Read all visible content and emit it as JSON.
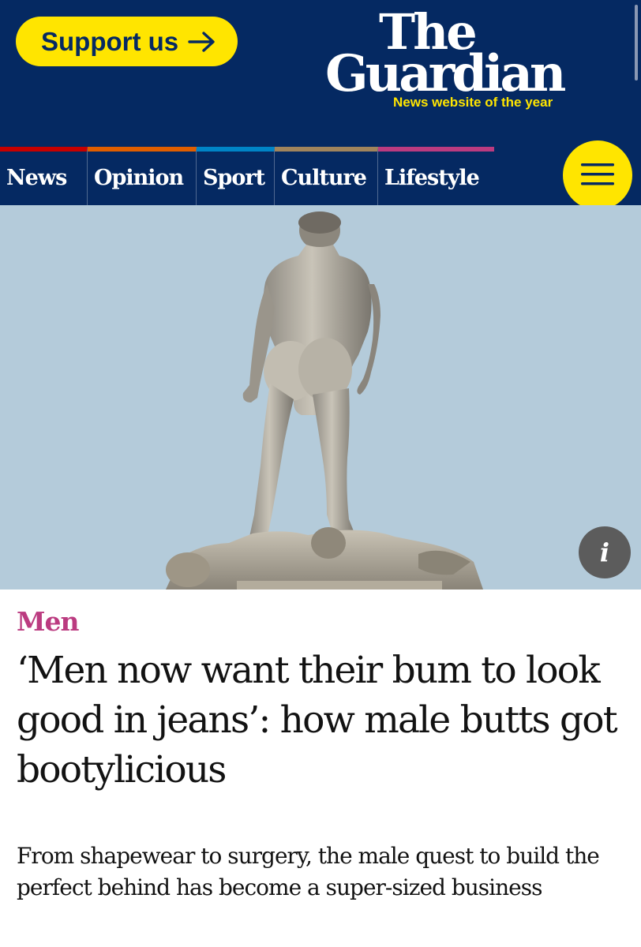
{
  "header": {
    "support_label": "Support us",
    "logo_line1": "The",
    "logo_line2": "Guardian",
    "tagline": "News website of the year",
    "menu_icon": "hamburger-menu-icon"
  },
  "nav": {
    "pillars": [
      {
        "label": "News",
        "color": "#c70000"
      },
      {
        "label": "Opinion",
        "color": "#e05e00"
      },
      {
        "label": "Sport",
        "color": "#0084c6"
      },
      {
        "label": "Culture",
        "color": "#a1845c"
      },
      {
        "label": "Lifestyle",
        "color": "#bb3b80"
      }
    ]
  },
  "hero": {
    "info_label": "i"
  },
  "article": {
    "kicker": "Men",
    "headline": "‘Men now want their bum to look good in jeans’: how male butts got bootylicious",
    "standfirst": "From shapewear to surgery, the male quest to build the perfect behind has become a super-sized business"
  },
  "colors": {
    "brand_blue": "#052962",
    "brand_yellow": "#ffe500",
    "lifestyle_pink": "#bb3b80",
    "sky": "#b4cbda"
  }
}
